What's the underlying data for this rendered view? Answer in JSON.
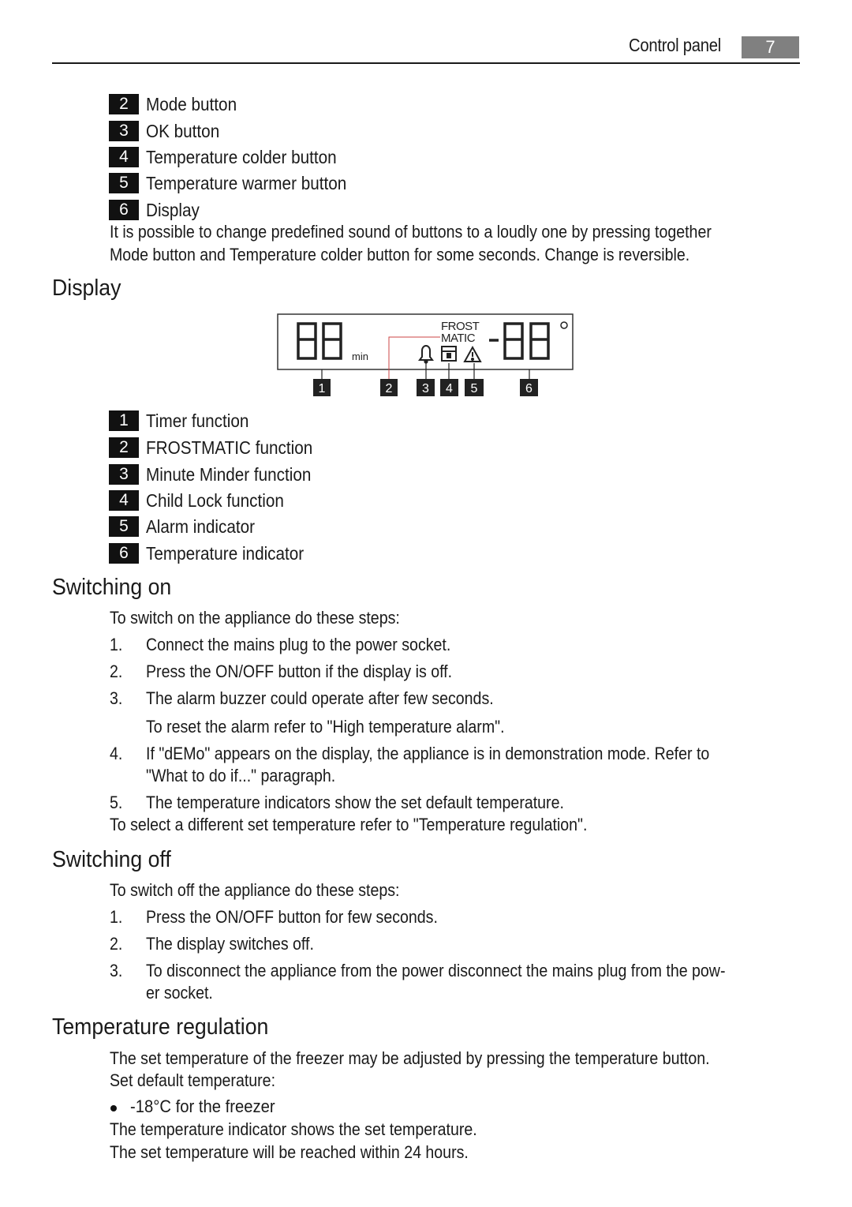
{
  "header": {
    "section_title": "Control panel",
    "page_number": "7"
  },
  "buttons_list": [
    {
      "num": "2",
      "label": "Mode button"
    },
    {
      "num": "3",
      "label": "OK button"
    },
    {
      "num": "4",
      "label": "Temperature colder button"
    },
    {
      "num": "5",
      "label": "Temperature warmer button"
    },
    {
      "num": "6",
      "label": "Display"
    }
  ],
  "sound_note": [
    "It is possible to change predefined sound of buttons to a loudly one by pressing together",
    "Mode button and Temperature colder button for some seconds. Change is reversible."
  ],
  "display_section": {
    "heading": "Display",
    "figure": {
      "left_digits": "88",
      "left_unit": "min",
      "frost_label_line1": "FROST",
      "frost_label_line2": "MATIC",
      "right_digits": "-88",
      "degree_symbol": "°",
      "icons": [
        "bell-icon",
        "child-lock-icon",
        "alarm-warning-icon"
      ],
      "callouts": [
        "1",
        "2",
        "3",
        "4",
        "5",
        "6"
      ]
    },
    "items": [
      {
        "num": "1",
        "label": "Timer function"
      },
      {
        "num": "2",
        "label": "FROSTMATIC function"
      },
      {
        "num": "3",
        "label": "Minute Minder function"
      },
      {
        "num": "4",
        "label": "Child Lock function"
      },
      {
        "num": "5",
        "label": "Alarm indicator"
      },
      {
        "num": "6",
        "label": "Temperature indicator"
      }
    ]
  },
  "switching_on": {
    "heading": "Switching on",
    "intro": "To switch on the appliance do these steps:",
    "steps": [
      {
        "num": "1.",
        "lines": [
          "Connect the mains plug to the power socket."
        ]
      },
      {
        "num": "2.",
        "lines": [
          "Press the ON/OFF button if the display is off."
        ]
      },
      {
        "num": "3.",
        "lines": [
          "The alarm buzzer could operate after few seconds."
        ]
      },
      {
        "num": "",
        "lines": [
          "To reset the alarm refer to \"High temperature alarm\"."
        ]
      },
      {
        "num": "4.",
        "lines": [
          "If \"dEMo\" appears on the display, the appliance is in demonstration mode. Refer to",
          "\"What to do if...\" paragraph."
        ]
      },
      {
        "num": "5.",
        "lines": [
          "The temperature indicators show the set default temperature."
        ]
      }
    ],
    "outro": "To select a different set temperature refer to \"Temperature regulation\"."
  },
  "switching_off": {
    "heading": "Switching off",
    "intro": "To switch off the appliance do these steps:",
    "steps": [
      {
        "num": "1.",
        "lines": [
          "Press the ON/OFF button for few seconds."
        ]
      },
      {
        "num": "2.",
        "lines": [
          "The display switches off."
        ]
      },
      {
        "num": "3.",
        "lines": [
          "To disconnect the appliance from the power disconnect the mains plug from the pow-",
          "er socket."
        ]
      }
    ]
  },
  "temperature_regulation": {
    "heading": "Temperature regulation",
    "para1": [
      "The set temperature of the freezer may be adjusted by pressing the temperature button.",
      "Set default temperature:"
    ],
    "bullet": "-18°C for the freezer",
    "para2": [
      "The temperature indicator shows the set temperature.",
      "The set temperature will be reached within 24 hours."
    ]
  }
}
